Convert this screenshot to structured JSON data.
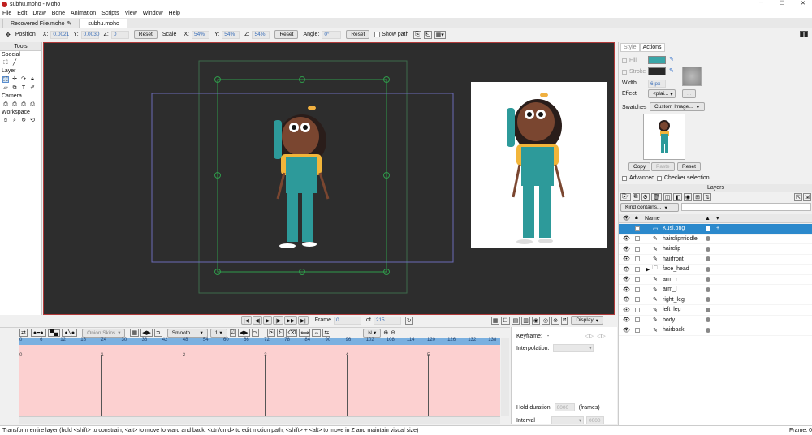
{
  "app": {
    "window_title": "subhu.moho - Moho"
  },
  "menu": [
    "File",
    "Edit",
    "Draw",
    "Bone",
    "Animation",
    "Scripts",
    "View",
    "Window",
    "Help"
  ],
  "tabs": [
    {
      "label": "Recovered File.moho"
    },
    {
      "label": "subhu.moho"
    }
  ],
  "tool_options": {
    "position_label": "Position",
    "x_label": "X:",
    "x_value": "0.0021",
    "y_label": "Y:",
    "y_value": "0.0030",
    "z_label": "Z:",
    "z_value": "0",
    "reset": "Reset",
    "scale_label": "Scale",
    "sx_label": "X:",
    "sx": "54%",
    "sy_label": "Y:",
    "sy": "54%",
    "sz_label": "Z:",
    "sz": "54%",
    "angle_label": "Angle:",
    "angle": "0°",
    "show_path": "Show path"
  },
  "tools": {
    "title": "Tools",
    "special": "Special",
    "layer": "Layer",
    "camera": "Camera",
    "workspace": "Workspace"
  },
  "playback": {
    "frame_label": "Frame",
    "frame": "0",
    "of_label": "of",
    "total": "215",
    "display": "Display"
  },
  "timeline": {
    "onion_skins": "Onion Skins",
    "smooth": "Smooth",
    "interp_num": "1",
    "n_label": "N",
    "ticks": [
      "0",
      "6",
      "12",
      "18",
      "24",
      "30",
      "36",
      "42",
      "48",
      "54",
      "60",
      "66",
      "72",
      "78",
      "84",
      "90",
      "96",
      "102",
      "108",
      "114",
      "120",
      "126",
      "132",
      "138"
    ],
    "markers": [
      "0",
      "1",
      "2",
      "3",
      "4",
      "5"
    ]
  },
  "keyframe": {
    "keyframe_label": "Keyframe:",
    "keyframe_value": "-",
    "interpolation": "Interpolation:",
    "hold_duration": "Hold duration",
    "hold_value": "0000",
    "frames": "(frames)",
    "interval": "Interval",
    "interval_value": "0000"
  },
  "style": {
    "tab_style": "Style",
    "tab_actions": "Actions",
    "fill": "Fill",
    "stroke": "Stroke",
    "fill_color": "#3aa6a8",
    "stroke_color": "#2a2a2a",
    "width_label": "Width",
    "width_value": "6 px",
    "effect_label": "Effect",
    "effect_value": "<plai...",
    "swatches_label": "Swatches",
    "swatches_value": "Custom Image...",
    "copy": "Copy",
    "paste": "Paste",
    "reset": "Reset",
    "advanced": "Advanced",
    "checker": "Checker selection"
  },
  "layers": {
    "title": "Layers",
    "filter": "Kind contains...",
    "name_col": "Name",
    "items": [
      {
        "name": "Kusi.png",
        "selected": true
      },
      {
        "name": "hairclipmiddle"
      },
      {
        "name": "hairclip"
      },
      {
        "name": "hairfront"
      },
      {
        "name": "face_head"
      },
      {
        "name": "arm_r"
      },
      {
        "name": "arm_l"
      },
      {
        "name": "right_leg"
      },
      {
        "name": "left_leg"
      },
      {
        "name": "body"
      },
      {
        "name": "hairback"
      }
    ]
  },
  "status": {
    "text": "Transform entire layer (hold <shift> to constrain, <alt> to move forward and back, <ctrl/cmd> to edit motion path, <shift> + <alt> to move in Z and maintain visual size)",
    "frame": "Frame: 0"
  },
  "colors": {
    "accent": "#2b89cc",
    "canvas_bg": "#2d2d2d",
    "timeline_track": "#fcd0d0",
    "ruler": "#7ab0e0"
  }
}
